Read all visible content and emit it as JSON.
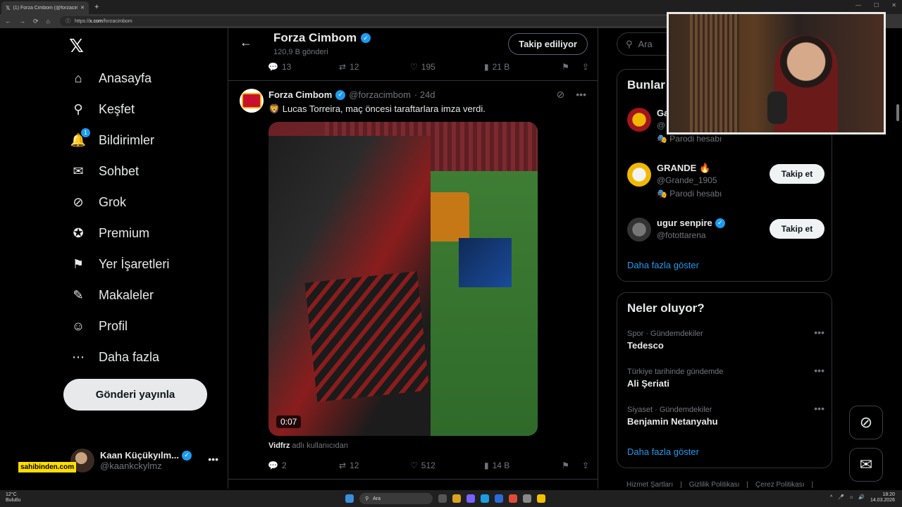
{
  "browser": {
    "tab_title": "(1) Forza Cimbom (@forzacimbom...",
    "url_prefix": "https://",
    "url_host": "x.com",
    "url_path": "/forzacimbom"
  },
  "nav": {
    "items": [
      {
        "label": "Anasayfa",
        "icon": "⌂"
      },
      {
        "label": "Keşfet",
        "icon": "⚲"
      },
      {
        "label": "Bildirimler",
        "icon": "🔔",
        "badge": "1"
      },
      {
        "label": "Sohbet",
        "icon": "✉"
      },
      {
        "label": "Grok",
        "icon": "⊘"
      },
      {
        "label": "Premium",
        "icon": "✪"
      },
      {
        "label": "Yer İşaretleri",
        "icon": "⚑"
      },
      {
        "label": "Makaleler",
        "icon": "✎"
      },
      {
        "label": "Profil",
        "icon": "☺"
      },
      {
        "label": "Daha fazla",
        "icon": "⋯"
      }
    ],
    "post_button": "Gönderi yayınla",
    "account_name": "Kaan Küçükyılm...",
    "account_handle": "@kaankckylmz",
    "sticker": "sahibinden.com"
  },
  "header": {
    "title": "Forza Cimbom",
    "post_count": "120,9 B gönderi",
    "follow_label": "Takip ediliyor"
  },
  "prev_actions": {
    "replies": "13",
    "reposts": "12",
    "likes": "195",
    "views": "21 B"
  },
  "tweet": {
    "name": "Forza Cimbom",
    "handle": "@forzacimbom",
    "time": "· 24d",
    "text": "🦁 Lucas Torreira, maç öncesi taraftarlara imza verdi.",
    "video_time": "0:07",
    "via_user": "Vidfrz",
    "via_text": " adlı kullanıcıdan",
    "replies": "2",
    "reposts": "12",
    "likes": "512",
    "views": "14 B"
  },
  "right": {
    "search_placeholder": "Ara",
    "who_title": "Bunlar",
    "who": [
      {
        "name": "Ga",
        "handle": "@",
        "sub": "Parodi hesabı",
        "follow": ""
      },
      {
        "name": "GRANDE 🔥",
        "handle": "@Grande_1905",
        "sub": "Parodi hesabı",
        "follow": "Takip et"
      },
      {
        "name": "ugur senpire",
        "handle": "@fotottarena",
        "sub": "",
        "follow": "Takip et"
      }
    ],
    "who_more": "Daha fazla göster",
    "trends_title": "Neler oluyor?",
    "trends": [
      {
        "cat": "Spor · Gündemdekiler",
        "title": "Tedesco"
      },
      {
        "cat": "Türkiye tarihinde gündemde",
        "title": "Ali Şeriati"
      },
      {
        "cat": "Siyaset · Gündemdekiler",
        "title": "Benjamin Netanyahu"
      }
    ],
    "trends_more": "Daha fazla göster",
    "footer": [
      "Hizmet Şartları",
      "|",
      "Gizlilik Politikası",
      "|",
      "Çerez Politikası",
      "|"
    ]
  },
  "taskbar": {
    "temp": "12°C",
    "weather": "Bulutlu",
    "search": "Ara",
    "time": "18:20",
    "date": "14.03.2026"
  }
}
